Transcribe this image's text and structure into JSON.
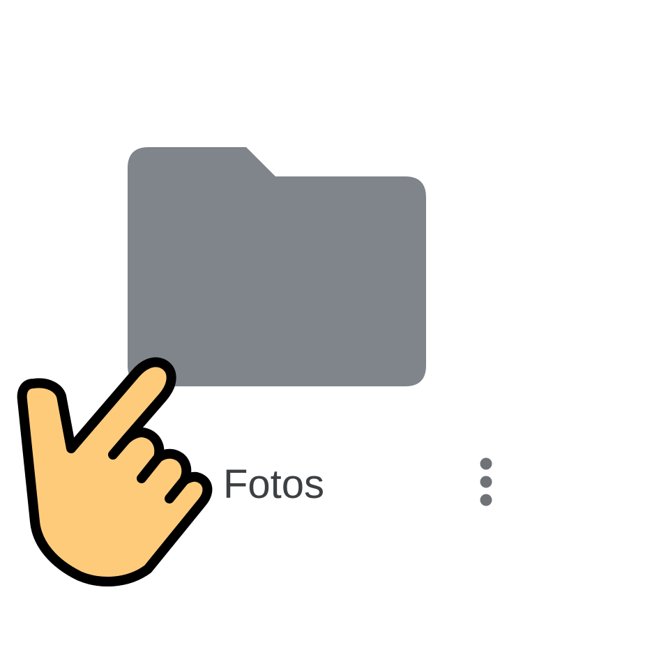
{
  "folder": {
    "name": "Fotos",
    "icon": "folder-icon",
    "color": "#80848b"
  },
  "more_button": {
    "icon": "more-vert-icon",
    "color": "#6f7378"
  },
  "pointer": {
    "icon": "pointing-hand-icon",
    "fill": "#fecb7b",
    "stroke": "#000000"
  }
}
